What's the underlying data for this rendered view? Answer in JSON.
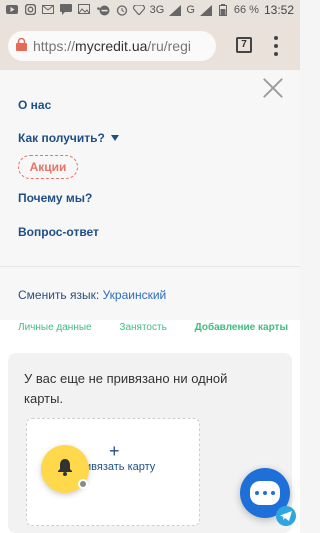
{
  "status_bar": {
    "battery_percent": "66 %",
    "time": "13:52",
    "network": "3G"
  },
  "browser": {
    "url_prefix": "https://",
    "url_domain": "mycredit.ua",
    "url_path": "/ru/regi",
    "tab_count": "7"
  },
  "menu": {
    "about": "О нас",
    "how_to_get": "Как получить?",
    "promotions": "Акции",
    "why_us": "Почему мы?",
    "faq": "Вопрос-ответ",
    "language_label": "Сменить язык:",
    "language_value": "Украинский"
  },
  "steps": [
    "Личные данные",
    "Занятость",
    "Добавление карты"
  ],
  "card_section": {
    "message": "У вас еще не привязано ни одной карты.",
    "add_card_label": "Привязать карту",
    "add_plus": "+"
  },
  "icons": {
    "bell_fab": "bell-icon",
    "chat": "chat-icon",
    "telegram": "telegram-icon",
    "close": "close-icon"
  }
}
